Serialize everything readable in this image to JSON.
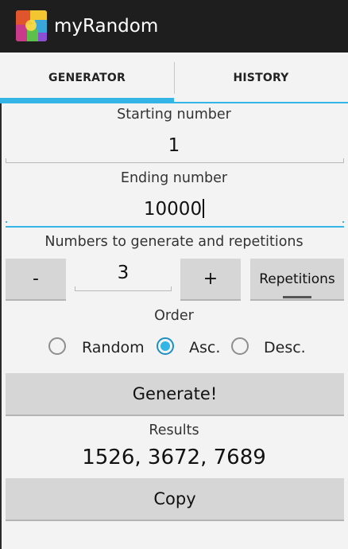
{
  "app": {
    "title": "myRandom",
    "icon": "app-icon"
  },
  "tabs": [
    {
      "label": "GENERATOR",
      "selected": true
    },
    {
      "label": "HISTORY",
      "selected": false
    }
  ],
  "form": {
    "start_label": "Starting number",
    "start_value": "1",
    "end_label": "Ending number",
    "end_value": "10000",
    "count_label": "Numbers to generate and repetitions",
    "minus_label": "-",
    "count_value": "3",
    "plus_label": "+",
    "repetitions_label": "Repetitions",
    "order_label": "Order",
    "order_options": [
      {
        "label": "Random",
        "checked": false
      },
      {
        "label": "Asc.",
        "checked": true
      },
      {
        "label": "Desc.",
        "checked": false
      }
    ],
    "generate_label": "Generate!",
    "results_label": "Results",
    "results_value": "1526, 3672, 7689",
    "copy_label": "Copy"
  },
  "colors": {
    "accent": "#33b5e5",
    "actionbar": "#1e1e1e",
    "background": "#f3f3f3",
    "button": "#d6d6d6"
  }
}
